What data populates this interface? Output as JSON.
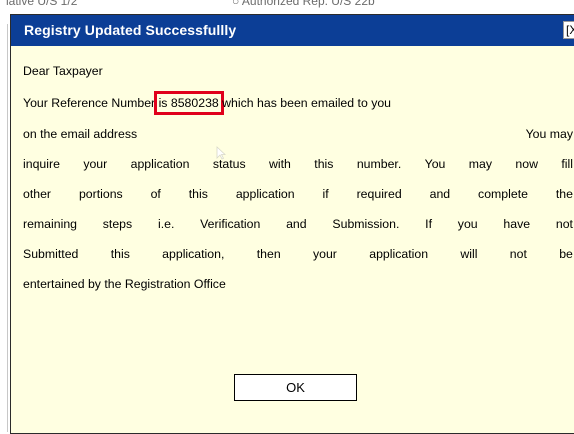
{
  "background": {
    "left_text": "lative U/S 1/2",
    "right_text": "○  Authorized Rep. U/S 22b"
  },
  "dialog": {
    "title": "Registry Updated Successfullly",
    "close_label": "[X]",
    "greeting": "Dear Taxpayer",
    "message": {
      "line1_before": "Your Reference Number",
      "reference_number": "is 8580238",
      "line1_after": "which has been emailed to you",
      "line2_left": "on the email address",
      "line2_right": "You may",
      "line3": [
        "inquire",
        "your",
        "application",
        "status",
        "with",
        "this",
        "number.",
        "You",
        "may",
        "now",
        "fill"
      ],
      "line4": [
        "other",
        "portions",
        "of",
        "this",
        "application",
        "if",
        "required",
        "and",
        "complete",
        "the"
      ],
      "line5": [
        "remaining",
        "steps",
        "i.e.",
        "Verification",
        "and",
        "Submission.",
        "If",
        "you",
        "have",
        "not"
      ],
      "line6": [
        "Submitted",
        "this",
        "application,",
        "then",
        "your",
        "application",
        "will",
        "not",
        "be"
      ],
      "line7": "entertained by the Registration Office"
    },
    "ok_label": "OK"
  },
  "colors": {
    "titlebar": "#0c3e96",
    "dialog_background": "#ffffe1",
    "highlight_box": "#e0001b"
  }
}
